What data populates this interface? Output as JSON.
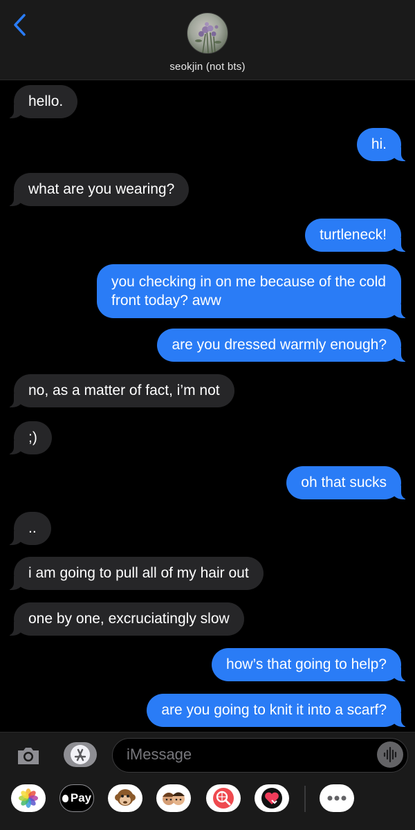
{
  "header": {
    "contact_name": "seokjin (not bts)"
  },
  "messages": [
    {
      "dir": "in",
      "text": "hello."
    },
    {
      "dir": "out",
      "text": "hi."
    },
    {
      "dir": "in",
      "text": "what are you wearing?"
    },
    {
      "dir": "out",
      "text": "turtleneck!"
    },
    {
      "dir": "out",
      "text": "you checking in on me because of the cold front today? aww"
    },
    {
      "dir": "out",
      "text": "are you dressed warmly enough?"
    },
    {
      "dir": "in",
      "text": "no, as a matter of fact, i’m not"
    },
    {
      "dir": "in",
      "text": ";)"
    },
    {
      "dir": "out",
      "text": "oh that sucks"
    },
    {
      "dir": "in",
      "text": ".."
    },
    {
      "dir": "in",
      "text": "i am going to pull all of my hair out"
    },
    {
      "dir": "in",
      "text": "one by one, excruciatingly slow"
    },
    {
      "dir": "out",
      "text": "how’s that going to help?"
    },
    {
      "dir": "out",
      "text": "are you going to knit it into a scarf?"
    }
  ],
  "composer": {
    "placeholder": "iMessage",
    "apple_pay_label": "Pay"
  },
  "colors": {
    "outgoing_bubble": "#2a7cf6",
    "incoming_bubble": "#262628",
    "accent": "#2a7cf6"
  }
}
